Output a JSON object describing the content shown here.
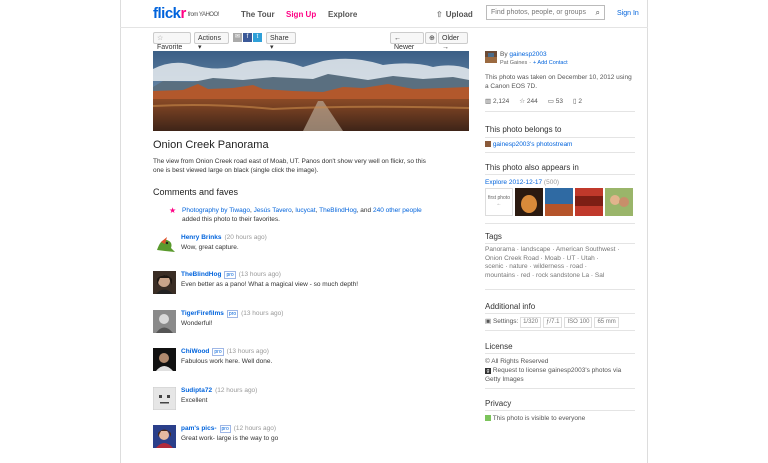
{
  "header": {
    "logo_f1": "flick",
    "logo_f2": "r",
    "logo_yahoo": "from YAHOO!",
    "nav_tour": "The Tour",
    "nav_signup": "Sign Up",
    "nav_explore": "Explore",
    "upload": "Upload",
    "search_placeholder": "Find photos, people, or groups",
    "signin": "Sign In"
  },
  "toolbar": {
    "favorite": "Favorite",
    "actions": "Actions",
    "share": "Share",
    "newer": "Newer",
    "older": "Older"
  },
  "photo": {
    "title": "Onion Creek Panorama",
    "description": "The view from Onion Creek road east of Moab, UT. Panos don't show very well on flickr, so this one is best viewed large on black (single click the image)."
  },
  "comments_section": {
    "heading": "Comments and faves",
    "faves_people": [
      "Photography by Tiwago",
      "Jesús Tavero",
      "lucycat",
      "TheBlindHog"
    ],
    "faves_sep_and": ", and",
    "faves_others": "240 other people",
    "faves_suffix": "added this photo to their favorites.",
    "comments": [
      {
        "name": "Henry Brinks",
        "pro": false,
        "time": "(20 hours ago)",
        "text": "Wow, great capture."
      },
      {
        "name": "TheBlindHog",
        "pro": true,
        "time": "(13 hours ago)",
        "text": "Even better as a pano! What a magical view - so much depth!"
      },
      {
        "name": "TigerFirefilms",
        "pro": true,
        "time": "(13 hours ago)",
        "text": "Wonderful!"
      },
      {
        "name": "ChiWood",
        "pro": true,
        "time": "(13 hours ago)",
        "text": "Fabulous work here. Well done."
      },
      {
        "name": "Sudipta72",
        "pro": false,
        "time": "(12 hours ago)",
        "text": "Excellent"
      },
      {
        "name": "pam's pics-",
        "pro": true,
        "time": "(12 hours ago)",
        "text": "Great work- large is the way to go"
      }
    ],
    "pro_label": "pro"
  },
  "sidebar": {
    "by_prefix": "By",
    "owner": "gainesp2003",
    "owner_sub": "Pat Gaines",
    "add_contact": "+ Add Contact",
    "taken": "This photo was taken on December 10, 2012 using a Canon EOS 7D.",
    "stats": {
      "views": "2,124",
      "faves": "244",
      "comments": "53",
      "sets": "2"
    },
    "belongs_heading": "This photo belongs to",
    "photostream": "gainesp2003's photostream",
    "appears_heading": "This photo also appears in",
    "explore_link": "Explore 2012-12-17",
    "explore_count": "(500)",
    "first_photo": "first photo",
    "tags_heading": "Tags",
    "tags": [
      "Panorama",
      "landscape",
      "American Southwest",
      "Onion Creek Road",
      "Moab",
      "UT",
      "Utah",
      "scenic",
      "nature",
      "wilderness",
      "road",
      "mountains",
      "red",
      "rock sandstone La",
      "Sal"
    ],
    "info_heading": "Additional info",
    "settings_label": "Settings:",
    "settings": [
      "1/320",
      "ƒ/7.1",
      "ISO 100",
      "65 mm"
    ],
    "license_heading": "License",
    "rights": "All Rights Reserved",
    "request": "Request to license gainesp2003's photos via Getty Images",
    "privacy_heading": "Privacy",
    "privacy_text": "This photo is visible to everyone"
  },
  "colors": {
    "flickr_blue": "#0063dc",
    "flickr_pink": "#ff0084"
  }
}
